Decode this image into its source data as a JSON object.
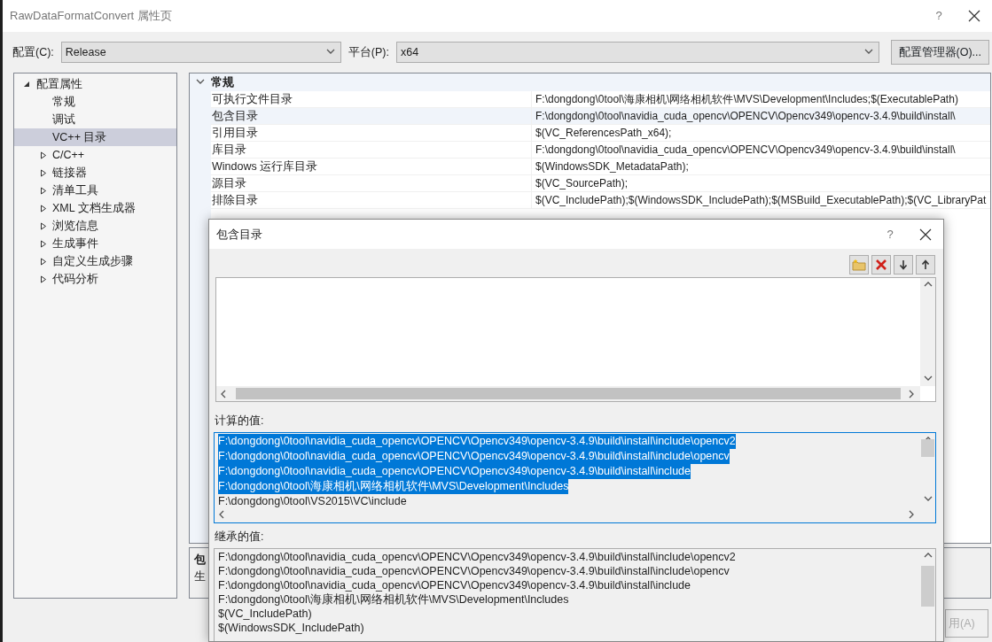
{
  "window": {
    "title": "RawDataFormatConvert 属性页",
    "help": "?"
  },
  "toolbar": {
    "config_label": "配置(C):",
    "config_value": "Release",
    "platform_label": "平台(P):",
    "platform_value": "x64",
    "manager_button": "配置管理器(O)..."
  },
  "tree": [
    {
      "label": "配置属性",
      "expanded": true,
      "selected": false,
      "children": [
        {
          "label": "常规",
          "selected": false
        },
        {
          "label": "调试",
          "selected": false
        },
        {
          "label": "VC++ 目录",
          "selected": true
        },
        {
          "label": "C/C++",
          "selected": false,
          "expanded": false
        },
        {
          "label": "链接器",
          "selected": false,
          "expanded": false
        },
        {
          "label": "清单工具",
          "selected": false,
          "expanded": false
        },
        {
          "label": "XML 文档生成器",
          "selected": false,
          "expanded": false
        },
        {
          "label": "浏览信息",
          "selected": false,
          "expanded": false
        },
        {
          "label": "生成事件",
          "selected": false,
          "expanded": false
        },
        {
          "label": "自定义生成步骤",
          "selected": false,
          "expanded": false
        },
        {
          "label": "代码分析",
          "selected": false,
          "expanded": false
        }
      ]
    }
  ],
  "property_grid": {
    "category": {
      "label": "常规",
      "expanded": true
    },
    "rows": [
      {
        "name": "可执行文件目录",
        "value": "F:\\dongdong\\0tool\\海康相机\\网络相机软件\\MVS\\Development\\Includes;$(ExecutablePath)",
        "selected": false
      },
      {
        "name": "包含目录",
        "value": "F:\\dongdong\\0tool\\navidia_cuda_opencv\\OPENCV\\Opencv349\\opencv-3.4.9\\build\\install\\",
        "selected": true
      },
      {
        "name": "引用目录",
        "value": "$(VC_ReferencesPath_x64);",
        "selected": false
      },
      {
        "name": "库目录",
        "value": "F:\\dongdong\\0tool\\navidia_cuda_opencv\\OPENCV\\Opencv349\\opencv-3.4.9\\build\\install\\",
        "selected": false
      },
      {
        "name": "Windows 运行库目录",
        "value": "$(WindowsSDK_MetadataPath);",
        "selected": false
      },
      {
        "name": "源目录",
        "value": "$(VC_SourcePath);",
        "selected": false
      },
      {
        "name": "排除目录",
        "value": "$(VC_IncludePath);$(WindowsSDK_IncludePath);$(MSBuild_ExecutablePath);$(VC_LibraryPat",
        "selected": false
      }
    ]
  },
  "description": {
    "title": "包",
    "text": "生"
  },
  "apply_button": {
    "label": "用(A)",
    "disabled": true
  },
  "dialog": {
    "title": "包含目录",
    "help": "?",
    "computed_label": "计算的值:",
    "computed_lines": [
      {
        "text": "F:\\dongdong\\0tool\\navidia_cuda_opencv\\OPENCV\\Opencv349\\opencv-3.4.9\\build\\install\\include\\opencv2",
        "selected": true
      },
      {
        "text": "F:\\dongdong\\0tool\\navidia_cuda_opencv\\OPENCV\\Opencv349\\opencv-3.4.9\\build\\install\\include\\opencv",
        "selected": true
      },
      {
        "text": "F:\\dongdong\\0tool\\navidia_cuda_opencv\\OPENCV\\Opencv349\\opencv-3.4.9\\build\\install\\include",
        "selected": true
      },
      {
        "text": "F:\\dongdong\\0tool\\海康相机\\网络相机软件\\MVS\\Development\\Includes",
        "selected": true
      },
      {
        "text": "F:\\dongdong\\0tool\\VS2015\\VC\\include",
        "selected": false
      }
    ],
    "inherited_label": "继承的值:",
    "inherited_lines": [
      "F:\\dongdong\\0tool\\navidia_cuda_opencv\\OPENCV\\Opencv349\\opencv-3.4.9\\build\\install\\include\\opencv2",
      "F:\\dongdong\\0tool\\navidia_cuda_opencv\\OPENCV\\Opencv349\\opencv-3.4.9\\build\\install\\include\\opencv",
      "F:\\dongdong\\0tool\\navidia_cuda_opencv\\OPENCV\\Opencv349\\opencv-3.4.9\\build\\install\\include",
      "F:\\dongdong\\0tool\\海康相机\\网络相机软件\\MVS\\Development\\Includes",
      "$(VC_IncludePath)",
      "$(WindowsSDK_IncludePath)"
    ]
  }
}
